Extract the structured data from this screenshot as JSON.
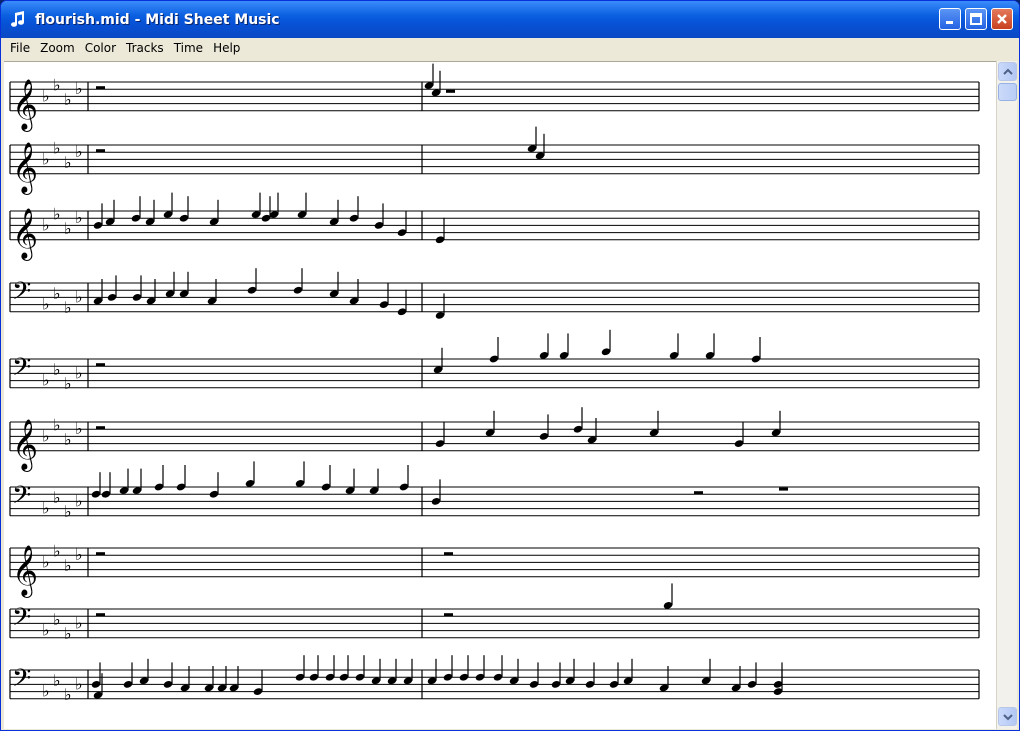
{
  "window": {
    "title": "flourish.mid - Midi Sheet Music",
    "icon": "music-note-icon"
  },
  "title_buttons": [
    "minimize-icon",
    "maximize-icon",
    "close-icon"
  ],
  "menu": [
    "File",
    "Zoom",
    "Color",
    "Tracks",
    "Time",
    "Help"
  ],
  "score": {
    "key_signature": "4 flats",
    "staves": [
      {
        "clef": "treble"
      },
      {
        "clef": "treble"
      },
      {
        "clef": "treble"
      },
      {
        "clef": "bass"
      },
      {
        "clef": "bass"
      },
      {
        "clef": "treble"
      },
      {
        "clef": "bass"
      },
      {
        "clef": "treble"
      },
      {
        "clef": "bass"
      },
      {
        "clef": "bass"
      }
    ]
  },
  "scrollbar": {
    "up": "scroll-up-icon",
    "down": "scroll-down-icon"
  }
}
